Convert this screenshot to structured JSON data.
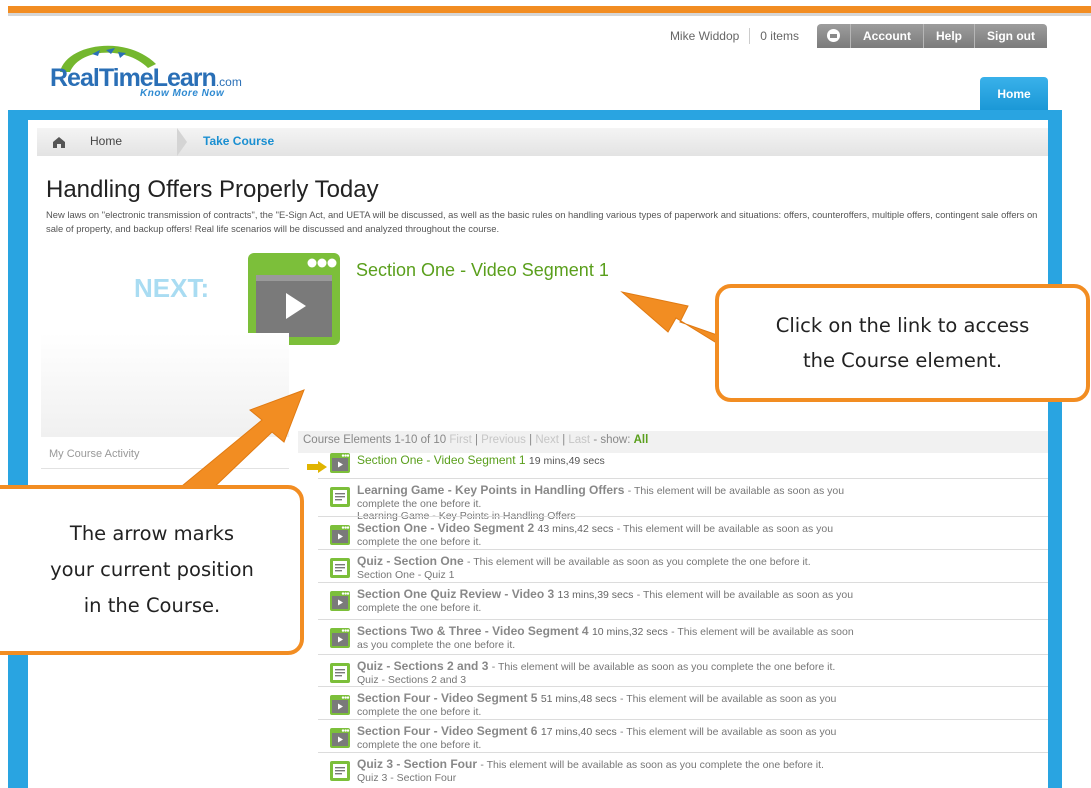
{
  "brand": {
    "logo_part1": "Real",
    "logo_part2": "Time",
    "logo_part3": "Learn",
    "logo_suffix": ".com",
    "tagline": "Know More Now"
  },
  "userbar": {
    "user_name": "Mike Widdop",
    "cart": "0 items",
    "buttons": [
      "Account",
      "Help",
      "Sign out"
    ]
  },
  "nav": {
    "home_tab": "Home"
  },
  "breadcrumb": {
    "home": "Home",
    "current": "Take Course"
  },
  "course": {
    "title": "Handling Offers Properly Today",
    "description": "New laws on \"electronic transmission of contracts\", the \"E-Sign Act, and UETA will be discussed, as well as the basic rules on handling various types of paperwork and situations: offers, counteroffers, multiple offers, contingent sale offers on sale of property, and backup offers! Real life scenarios will be discussed and analyzed throughout the course.",
    "next_label": "NEXT:",
    "next_link": "Section One - Video Segment 1"
  },
  "sidebar": {
    "title": "My Course Activity"
  },
  "list": {
    "summary": "Course Elements 1-10 of 10",
    "pager": {
      "first": "First",
      "sep1": "|",
      "previous": "Previous",
      "sep2": "|",
      "next": "Next",
      "sep3": "|",
      "last": "Last",
      "show": "- show:",
      "all": "All"
    },
    "current": {
      "title": "Section One - Video Segment 1",
      "duration": "19 mins,49 secs"
    },
    "items": [
      {
        "type": "quiz",
        "title": "Learning Game - Key Points in Handling Offers",
        "duration": "",
        "note": "- This element will be available as soon as you",
        "line2": "complete the one before it.",
        "line3": "Learning Game - Key Points in Handling Offers"
      },
      {
        "type": "video",
        "title": "Section One - Video Segment 2",
        "duration": "43 mins,42 secs",
        "note": "- This element will be available as soon as you",
        "line2": "complete the one before it.",
        "line3": ""
      },
      {
        "type": "quiz",
        "title": "Quiz - Section One",
        "duration": "",
        "note": "- This element will be available as soon as you complete the one before it.",
        "line2": "Section One - Quiz 1",
        "line3": ""
      },
      {
        "type": "video",
        "title": "Section One Quiz Review - Video 3",
        "duration": "13 mins,39 secs",
        "note": "- This element will be available as soon as you",
        "line2": "complete the one before it.",
        "line3": ""
      },
      {
        "type": "video",
        "title": "Sections Two & Three - Video Segment 4",
        "duration": "10 mins,32 secs",
        "note": "- This element will be available as soon",
        "line2": "as you complete the one before it.",
        "line3": ""
      },
      {
        "type": "quiz",
        "title": "Quiz - Sections 2 and 3",
        "duration": "",
        "note": "- This element will be available as soon as you complete the one before it.",
        "line2": "Quiz - Sections 2 and 3",
        "line3": ""
      },
      {
        "type": "video",
        "title": "Section Four - Video Segment 5",
        "duration": "51 mins,48 secs",
        "note": "- This element will be available as soon as you",
        "line2": "complete the one before it.",
        "line3": ""
      },
      {
        "type": "video",
        "title": "Section Four - Video Segment 6",
        "duration": "17 mins,40 secs",
        "note": "- This element will be available as soon as you",
        "line2": "complete the one before it.",
        "line3": ""
      },
      {
        "type": "quiz",
        "title": "Quiz 3 - Section Four",
        "duration": "",
        "note": "- This element will be available as soon as you complete the one before it.",
        "line2": "Quiz 3 - Section Four",
        "line3": ""
      }
    ]
  },
  "callouts": {
    "right_line1": "Click on the link to access",
    "right_line2": "the Course element.",
    "left_line1": "The arrow marks",
    "left_line2": "your current position",
    "left_line3": "in the Course."
  },
  "colors": {
    "accent_orange": "#f28d22",
    "brand_blue": "#29a4e1",
    "link_green": "#5a9f1c",
    "next_light_blue": "#a9dcf2"
  },
  "icons": {
    "video": "video-element-icon",
    "quiz": "document-element-icon",
    "home": "home-icon",
    "mail": "mail-icon",
    "current": "current-position-arrow-icon"
  }
}
